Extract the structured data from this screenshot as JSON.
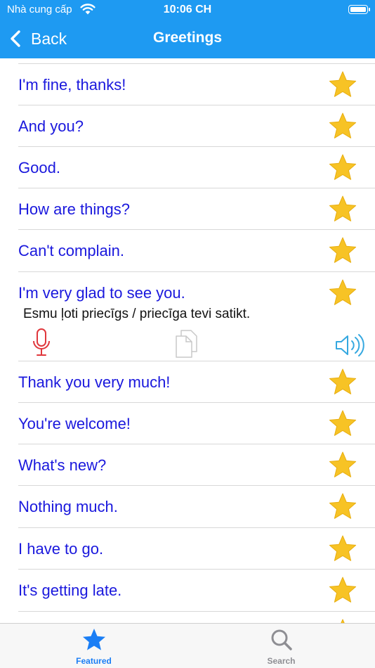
{
  "status": {
    "carrier": "Nhà cung cấp",
    "time": "10:06 CH"
  },
  "nav": {
    "back_label": "Back",
    "title": "Greetings"
  },
  "phrases": [
    {
      "text": "I'm fine, thanks!",
      "favorite": true
    },
    {
      "text": "And you?",
      "favorite": true
    },
    {
      "text": "Good.",
      "favorite": true
    },
    {
      "text": "How are things?",
      "favorite": true
    },
    {
      "text": "Can't complain.",
      "favorite": true
    },
    {
      "text": "I'm very glad to see you.",
      "favorite": true,
      "translation": "Esmu ļoti priecīgs / priecīga tevi satikt."
    },
    {
      "text": "Thank you very much!",
      "favorite": true
    },
    {
      "text": "You're welcome!",
      "favorite": true
    },
    {
      "text": "What's new?",
      "favorite": true
    },
    {
      "text": "Nothing much.",
      "favorite": true
    },
    {
      "text": "I have to go.",
      "favorite": true
    },
    {
      "text": "It's getting late.",
      "favorite": true
    }
  ],
  "tabs": [
    {
      "label": "Featured",
      "icon": "star-icon",
      "active": true
    },
    {
      "label": "Search",
      "icon": "search-icon",
      "active": false
    }
  ],
  "colors": {
    "nav_bar": "#1e9af2",
    "phrase_text": "#1a18dd",
    "star": "#f7c325",
    "mic": "#e0373c",
    "speaker": "#35a8e0",
    "tab_active": "#1a7ef5",
    "tab_inactive": "#8e8e93"
  }
}
